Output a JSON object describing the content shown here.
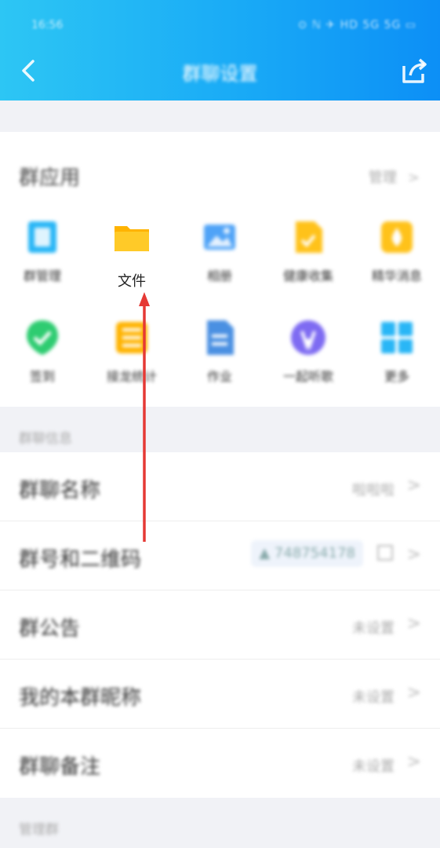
{
  "status_bar": {
    "time": "16:56",
    "icons": "⊙ ℕ ✈ HD 5G 5G ▭"
  },
  "header": {
    "title": "群聊设置"
  },
  "apps": {
    "title": "群应用",
    "manage_label": "管理",
    "items": [
      {
        "label": "群管理",
        "icon": "group-manage-icon",
        "color": "#29b6f6"
      },
      {
        "label": "文件",
        "icon": "folder-icon",
        "color": "#ffc107"
      },
      {
        "label": "相册",
        "icon": "photo-album-icon",
        "color": "#4fa3f7"
      },
      {
        "label": "健康收集",
        "icon": "health-collect-icon",
        "color": "#ffc21a"
      },
      {
        "label": "精华消息",
        "icon": "essence-icon",
        "color": "#ffc21a"
      },
      {
        "label": "签到",
        "icon": "checkin-icon",
        "color": "#2ecc71"
      },
      {
        "label": "接龙统计",
        "icon": "relay-stats-icon",
        "color": "#ffb300"
      },
      {
        "label": "作业",
        "icon": "homework-icon",
        "color": "#4a90e2"
      },
      {
        "label": "一起听歌",
        "icon": "music-icon",
        "color": "#7e6bf2"
      },
      {
        "label": "更多",
        "icon": "more-grid-icon",
        "color": "#29b6f6"
      }
    ]
  },
  "info": {
    "section_title": "群聊信息",
    "rows": [
      {
        "label": "群聊名称",
        "value": "啦啦啦"
      },
      {
        "label": "群号和二维码",
        "value": "748754178"
      },
      {
        "label": "群公告",
        "value": "未设置"
      },
      {
        "label": "我的本群昵称",
        "value": "未设置"
      },
      {
        "label": "群聊备注",
        "value": "未设置"
      }
    ]
  },
  "bottom_section_title": "管理群",
  "colors": {
    "header_start": "#2dc6f4",
    "header_end": "#0c8ff6",
    "arrow": "#e53935"
  }
}
